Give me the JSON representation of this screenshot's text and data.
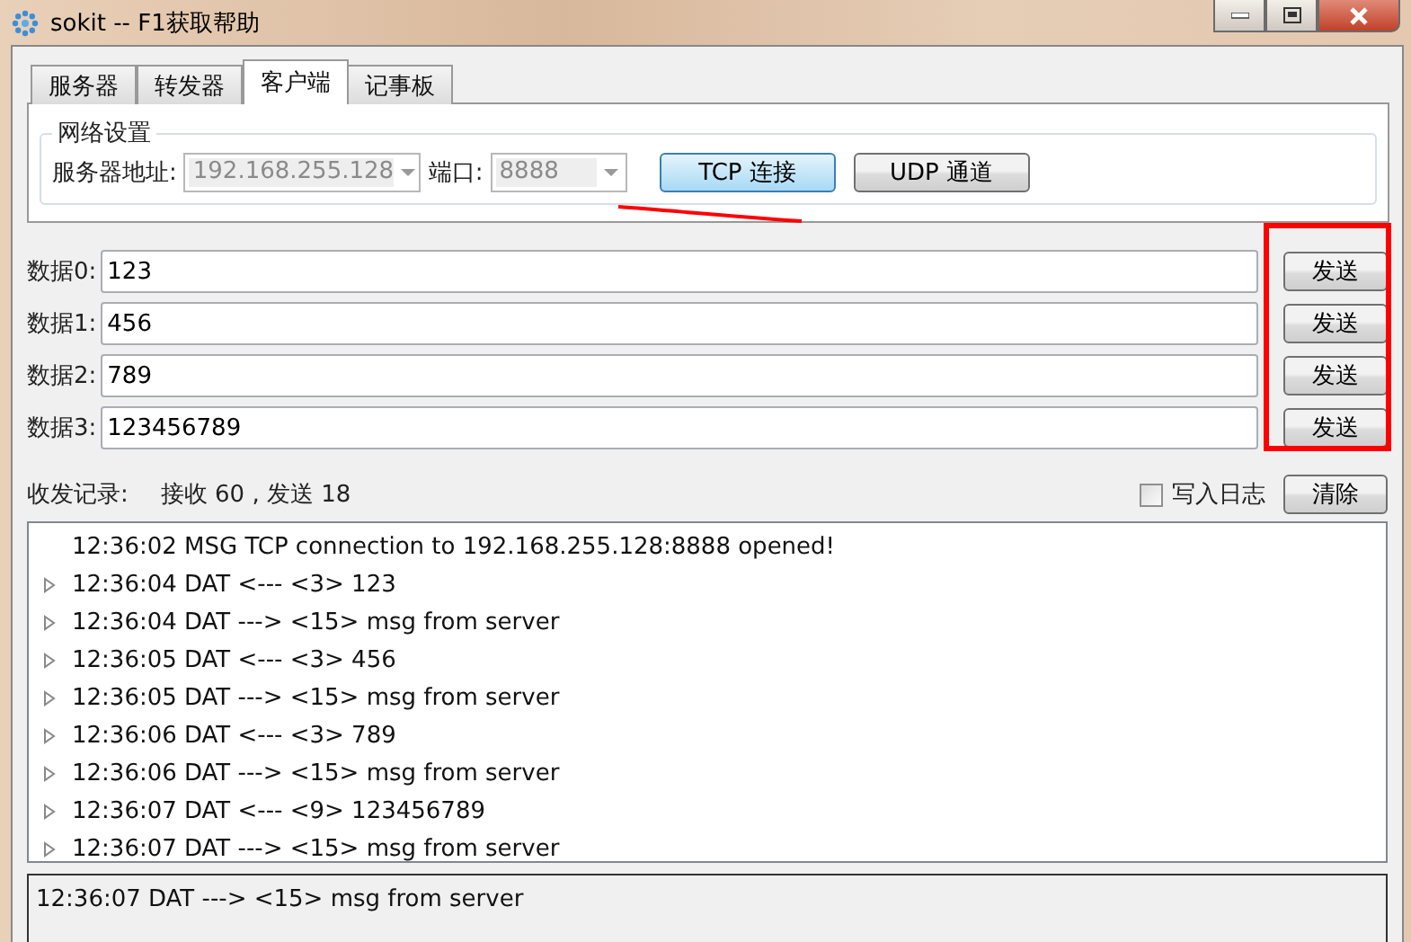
{
  "window": {
    "title": "sokit -- F1获取帮助"
  },
  "tabs": [
    {
      "label": "服务器",
      "selected": false
    },
    {
      "label": "转发器",
      "selected": false
    },
    {
      "label": "客户端",
      "selected": true
    },
    {
      "label": "记事板",
      "selected": false
    }
  ],
  "network": {
    "title": "网络设置",
    "address_label": "服务器地址:",
    "address": "192.168.255.128",
    "port_label": "端口:",
    "port": "8888",
    "buttons": [
      {
        "label": "TCP 连接",
        "selected": true
      },
      {
        "label": "UDP 通道",
        "selected": false
      }
    ]
  },
  "data_rows": [
    {
      "label": "数据0:",
      "value": "123",
      "button": "发送"
    },
    {
      "label": "数据1:",
      "value": "456",
      "button": "发送"
    },
    {
      "label": "数据2:",
      "value": "789",
      "button": "发送"
    },
    {
      "label": "数据3:",
      "value": "123456789",
      "button": "发送"
    }
  ],
  "stats": {
    "label": "收发记录:",
    "counts": "接收 60 , 发送 18",
    "log_checkbox": {
      "label": "写入日志",
      "checked": false
    },
    "clear_button": "清除"
  },
  "log": [
    {
      "text": "12:36:02 MSG TCP connection to 192.168.255.128:8888 opened!",
      "expandable": false
    },
    {
      "text": "12:36:04 DAT <--- <3> 123",
      "expandable": true
    },
    {
      "text": "12:36:04 DAT ---> <15> msg from server",
      "expandable": true
    },
    {
      "text": "12:36:05 DAT <--- <3> 456",
      "expandable": true
    },
    {
      "text": "12:36:05 DAT ---> <15> msg from server",
      "expandable": true
    },
    {
      "text": "12:36:06 DAT <--- <3> 789",
      "expandable": true
    },
    {
      "text": "12:36:06 DAT ---> <15> msg from server",
      "expandable": true
    },
    {
      "text": "12:36:07 DAT <--- <9> 123456789",
      "expandable": true
    },
    {
      "text": "12:36:07 DAT ---> <15> msg from server",
      "expandable": true
    }
  ],
  "detail": "12:36:07 DAT ---> <15> msg from server"
}
